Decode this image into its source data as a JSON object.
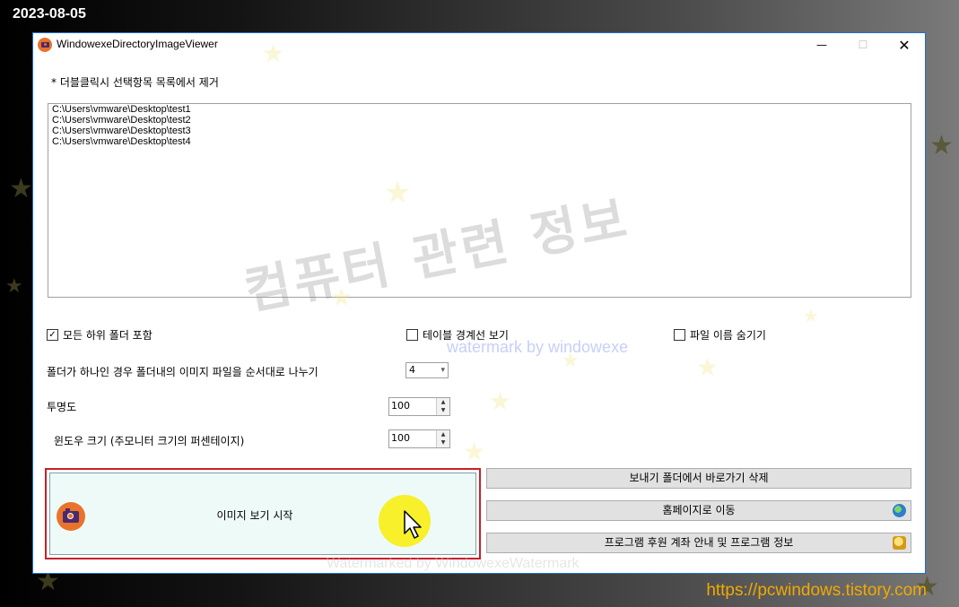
{
  "overlay": {
    "date_stamp": "2023-08-05",
    "site_url": "https://pcwindows.tistory.com",
    "watermark_main": "컴퓨터 관련 정보",
    "watermark_sub": "watermark by windowexe",
    "watermark_bottom": "Watermarked by WindowexeWatermark"
  },
  "window": {
    "title": "WindowexeDirectoryImageViewer",
    "minimize_glyph": "—",
    "maximize_glyph": "☐",
    "close_glyph": "✕"
  },
  "main": {
    "hint_label": "* 더블클릭시 선택항목 목록에서 제거",
    "folder_paths": [
      "C:\\Users\\vmware\\Desktop\\test1",
      "C:\\Users\\vmware\\Desktop\\test2",
      "C:\\Users\\vmware\\Desktop\\test3",
      "C:\\Users\\vmware\\Desktop\\test4"
    ],
    "include_subfolders": {
      "label": "모든 하위 폴더 포함",
      "checked": true,
      "mark": "✓"
    },
    "show_table_border": {
      "label": "테이블 경계선 보기",
      "checked": false,
      "mark": ""
    },
    "hide_file_names": {
      "label": "파일 이름 숨기기",
      "checked": false,
      "mark": ""
    },
    "split_label": "폴더가 하나인 경우 폴더내의 이미지 파일을 순서대로 나누기",
    "split_value": "4",
    "opacity_label": "투명도",
    "opacity_value": "100",
    "window_size_label": "윈도우 크기 (주모니터 크기의 퍼센테이지)",
    "window_size_value": "100",
    "start_button_label": "이미지 보기 시작",
    "delete_shortcut_button": "보내기 폴더에서 바로가기 삭제",
    "homepage_button": "홈페이지로 이동",
    "info_button": "프로그램 후원 계좌 안내 및 프로그램 정보"
  },
  "icons": {
    "app": "camera-icon",
    "start": "camera-icon",
    "homepage": "globe-icon",
    "info": "coins-icon",
    "combo_arrow": "▾",
    "spin_up": "▲",
    "spin_down": "▼"
  }
}
